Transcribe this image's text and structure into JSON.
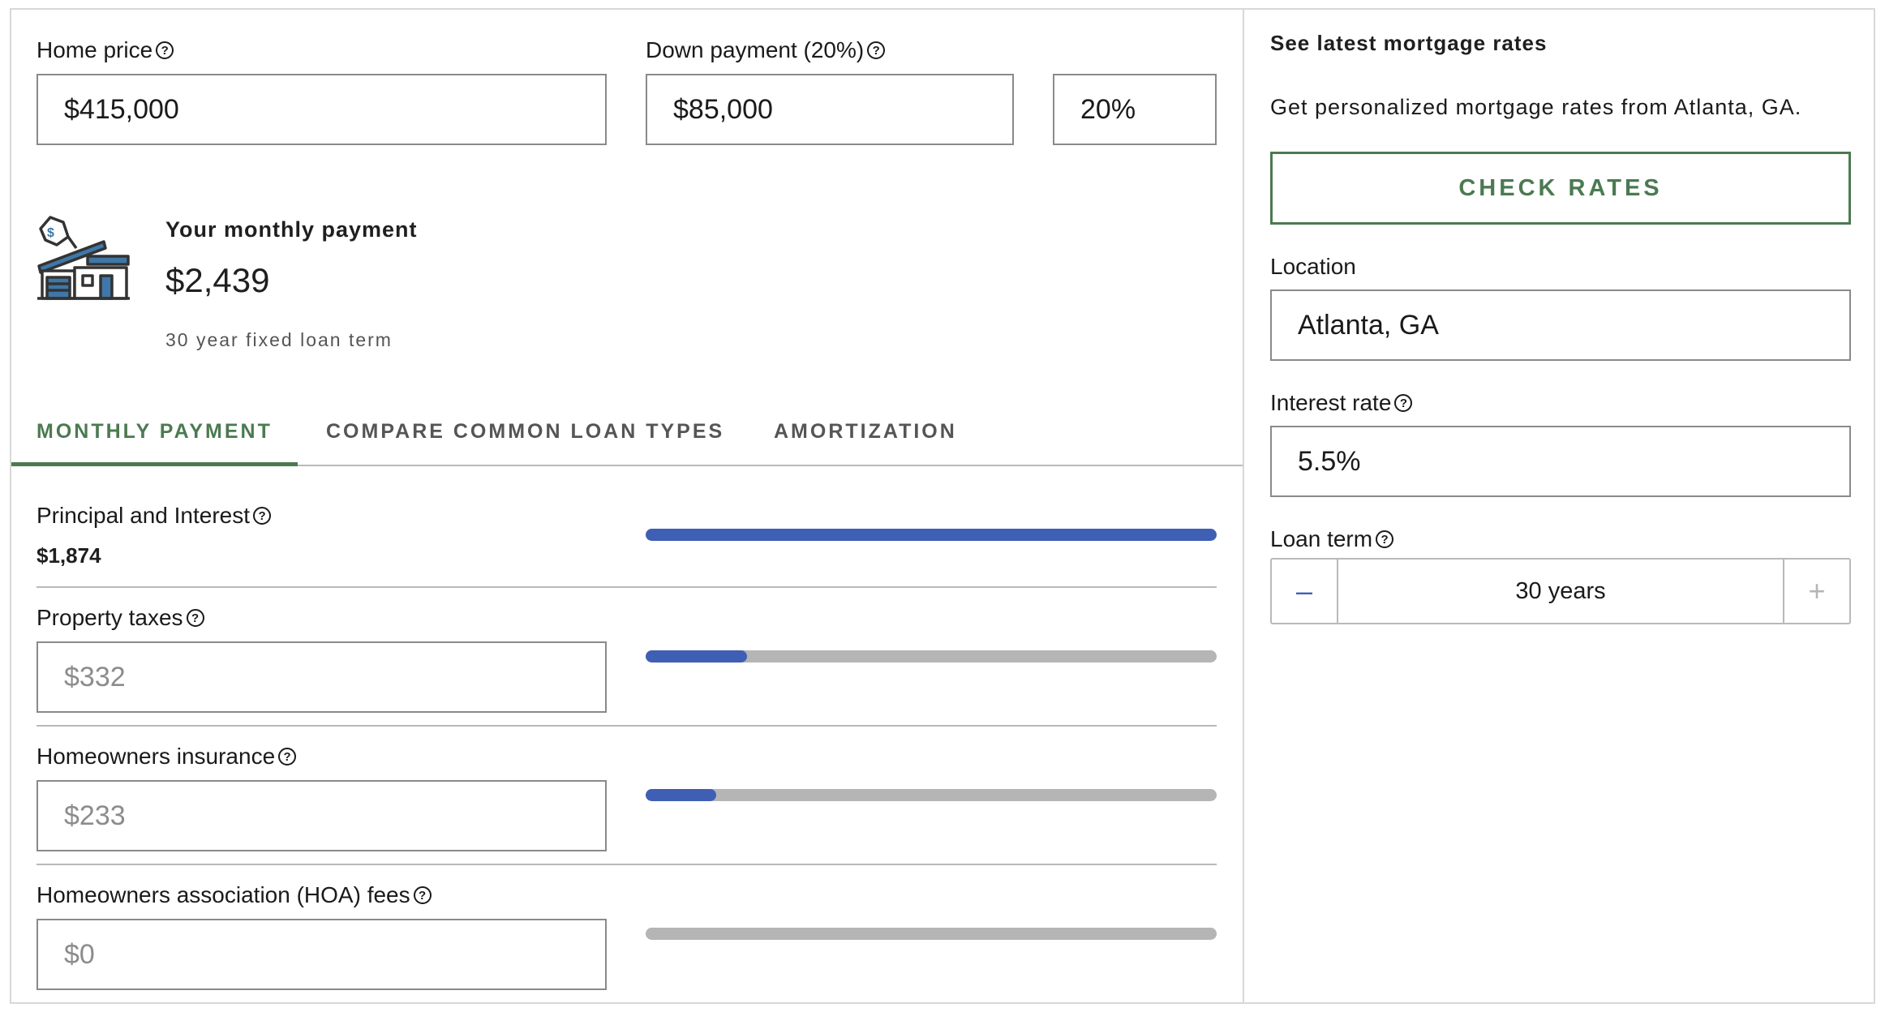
{
  "inputs": {
    "home_price_label": "Home price",
    "home_price_value": "$415,000",
    "down_payment_label": "Down payment (20%)",
    "down_payment_value": "$85,000",
    "down_payment_percent": "20%"
  },
  "summary": {
    "title": "Your monthly payment",
    "amount": "$2,439",
    "term": "30 year fixed loan term"
  },
  "tabs": [
    {
      "label": "MONTHLY PAYMENT",
      "active": true
    },
    {
      "label": "COMPARE COMMON LOAN TYPES",
      "active": false
    },
    {
      "label": "AMORTIZATION",
      "active": false
    }
  ],
  "breakdown": {
    "principal_label": "Principal and Interest",
    "principal_value": "$1,874",
    "principal_bar_fraction": 1.0,
    "taxes_label": "Property taxes",
    "taxes_placeholder": "$332",
    "taxes_bar_fraction": 0.177,
    "insurance_label": "Homeowners insurance",
    "insurance_placeholder": "$233",
    "insurance_bar_fraction": 0.124,
    "hoa_label": "Homeowners association (HOA) fees",
    "hoa_placeholder": "$0",
    "hoa_bar_fraction": 0.0
  },
  "sidebar": {
    "title": "See latest mortgage rates",
    "subtitle": "Get personalized mortgage rates from Atlanta, GA.",
    "check_rates": "CHECK RATES",
    "location_label": "Location",
    "location_value": "Atlanta, GA",
    "rate_label": "Interest rate",
    "rate_value": "5.5%",
    "term_label": "Loan term",
    "term_value": "30 years",
    "minus": "–",
    "plus": "+"
  },
  "colors": {
    "accent_green": "#4b7a51",
    "bar_blue": "#3f5fb5",
    "bar_gray": "#b5b5b5"
  },
  "icons": [
    "help-circle-icon",
    "house-price-tag-icon",
    "minus-icon",
    "plus-icon"
  ]
}
